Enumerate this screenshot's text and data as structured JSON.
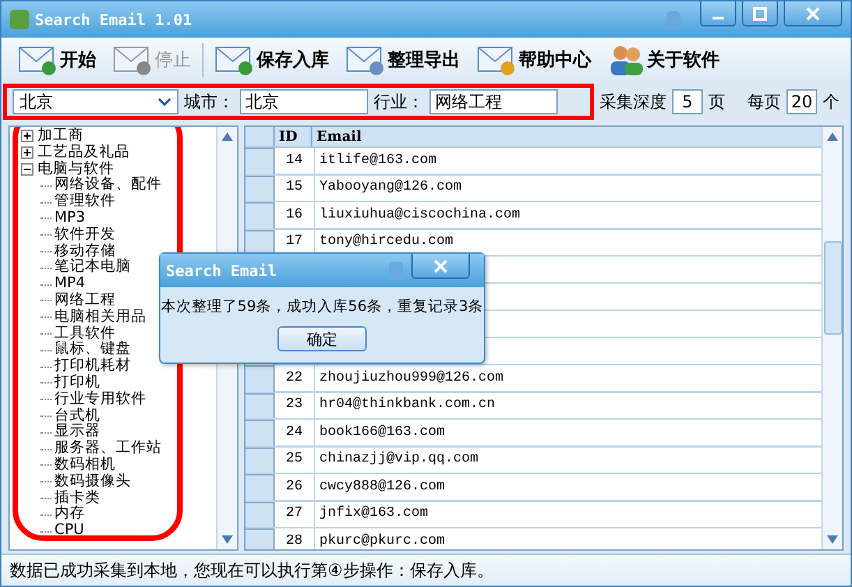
{
  "window": {
    "title": "Search Email 1.01"
  },
  "toolbar": [
    {
      "label": "开始",
      "kind": "start",
      "disabled": false
    },
    {
      "label": "停止",
      "kind": "stop",
      "disabled": true
    },
    {
      "label": "保存入库",
      "kind": "save",
      "disabled": false
    },
    {
      "label": "整理导出",
      "kind": "export",
      "disabled": false
    },
    {
      "label": "帮助中心",
      "kind": "help",
      "disabled": false
    },
    {
      "label": "关于软件",
      "kind": "about",
      "disabled": false
    }
  ],
  "search": {
    "province": "北京",
    "city_label": "城市：",
    "city": "北京",
    "industry_label": "行业：",
    "industry": "网络工程",
    "depth_label": "采集深度",
    "depth": "5",
    "depth_unit": "页",
    "per_page_label": "每页",
    "per_page": "20",
    "per_page_unit": "个"
  },
  "tree": [
    {
      "label": "加工商",
      "expanded": false
    },
    {
      "label": "工艺品及礼品",
      "expanded": false
    },
    {
      "label": "电脑与软件",
      "expanded": true,
      "children": [
        {
          "label": "网络设备、配件"
        },
        {
          "label": "管理软件"
        },
        {
          "label": "MP3"
        },
        {
          "label": "软件开发"
        },
        {
          "label": "移动存储"
        },
        {
          "label": "笔记本电脑"
        },
        {
          "label": "MP4"
        },
        {
          "label": "网络工程"
        },
        {
          "label": "电脑相关用品"
        },
        {
          "label": "工具软件"
        },
        {
          "label": "鼠标、键盘"
        },
        {
          "label": "打印机耗材"
        },
        {
          "label": "打印机"
        },
        {
          "label": "行业专用软件"
        },
        {
          "label": "台式机"
        },
        {
          "label": "显示器"
        },
        {
          "label": "服务器、工作站"
        },
        {
          "label": "数码相机"
        },
        {
          "label": "数码摄像头"
        },
        {
          "label": "插卡类"
        },
        {
          "label": "内存"
        },
        {
          "label": "CPU"
        }
      ]
    }
  ],
  "table": {
    "columns": [
      "ID",
      "Email"
    ],
    "rows": [
      {
        "id": "14",
        "email": "itlife@163.com"
      },
      {
        "id": "15",
        "email": "Yabooyang@126.com"
      },
      {
        "id": "16",
        "email": "liuxiuhua@ciscochina.com"
      },
      {
        "id": "17",
        "email": "tony@hircedu.com"
      },
      {
        "id": "22",
        "email": "zhoujiuzhou999@126.com"
      },
      {
        "id": "23",
        "email": "hr04@thinkbank.com.cn"
      },
      {
        "id": "24",
        "email": "book166@163.com"
      },
      {
        "id": "25",
        "email": "chinazjj@vip.qq.com"
      },
      {
        "id": "26",
        "email": "cwcy888@126.com"
      },
      {
        "id": "27",
        "email": "jnfix@163.com"
      },
      {
        "id": "28",
        "email": "pkurc@pkurc.com"
      }
    ]
  },
  "dialog": {
    "title": "Search Email",
    "message": "本次整理了59条，成功入库56条，重复记录3条",
    "button": "确定"
  },
  "status_bar": "数据已成功采集到本地，您现在可以执行第④步操作：保存入库。"
}
